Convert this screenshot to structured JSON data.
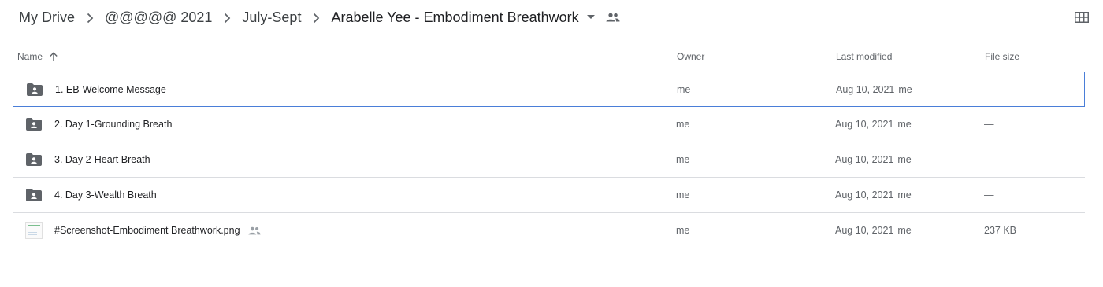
{
  "breadcrumb": {
    "items": [
      "My Drive",
      "@@@@@ 2021",
      "July-Sept",
      "Arabelle Yee - Embodiment Breathwork"
    ]
  },
  "table": {
    "headers": {
      "name": "Name",
      "owner": "Owner",
      "modified": "Last modified",
      "size": "File size"
    },
    "rows": [
      {
        "name": "1. EB-Welcome Message",
        "owner": "me",
        "modified": "Aug 10, 2021",
        "modified_by": "me",
        "size": "—",
        "type": "shared-folder",
        "selected": true
      },
      {
        "name": "2. Day 1-Grounding Breath",
        "owner": "me",
        "modified": "Aug 10, 2021",
        "modified_by": "me",
        "size": "—",
        "type": "shared-folder",
        "selected": false
      },
      {
        "name": "3. Day 2-Heart Breath",
        "owner": "me",
        "modified": "Aug 10, 2021",
        "modified_by": "me",
        "size": "—",
        "type": "shared-folder",
        "selected": false
      },
      {
        "name": "4. Day 3-Wealth Breath",
        "owner": "me",
        "modified": "Aug 10, 2021",
        "modified_by": "me",
        "size": "—",
        "type": "shared-folder",
        "selected": false
      },
      {
        "name": "#Screenshot-Embodiment Breathwork.png",
        "owner": "me",
        "modified": "Aug 10, 2021",
        "modified_by": "me",
        "size": "237 KB",
        "type": "image-file",
        "shared": true,
        "selected": false
      }
    ]
  },
  "icons": {
    "folder": "shared-folder-icon",
    "image": "image-thumbnail-icon",
    "people": "people-icon",
    "grid": "grid-view-icon",
    "sort": "arrow-up-icon",
    "dropdown": "caret-down-icon",
    "separator": "chevron-right-icon"
  },
  "colors": {
    "selected_border": "#4a7ed8",
    "folder": "#5f6368",
    "divider": "#dadce0"
  }
}
